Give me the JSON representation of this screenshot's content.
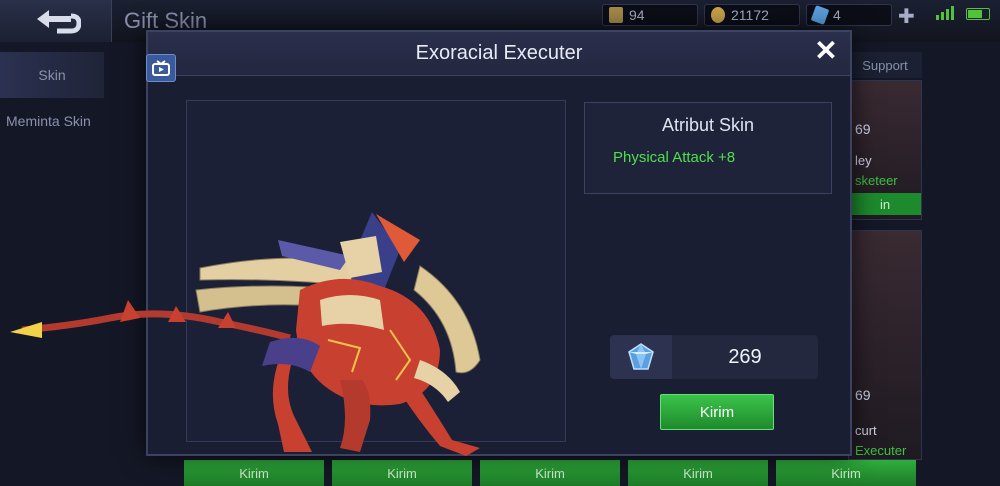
{
  "header": {
    "title": "Gift Skin",
    "resources": [
      {
        "name": "ticket",
        "value": "94",
        "color": "#a68a4a"
      },
      {
        "name": "battle-points",
        "value": "21172",
        "color": "#c9a24a"
      },
      {
        "name": "diamonds",
        "value": "4",
        "color": "#5aa0e0"
      }
    ]
  },
  "sidebar": {
    "items": [
      {
        "label": "Skin",
        "active": true
      },
      {
        "label": "Meminta Skin",
        "active": false
      }
    ]
  },
  "background": {
    "support_tab": "Support",
    "cards": [
      {
        "value": "69",
        "name": "ley",
        "role": "sketeer",
        "action": "in"
      },
      {
        "value": "69",
        "name": "curt",
        "role": "Executer",
        "action": ""
      }
    ],
    "bottom_buttons": [
      "Kirim",
      "Kirim",
      "Kirim",
      "Kirim",
      "Kirim"
    ]
  },
  "modal": {
    "title": "Exoracial Executer",
    "attributes": {
      "title": "Atribut Skin",
      "stat": "Physical Attack +8"
    },
    "price": "269",
    "send_label": "Kirim"
  },
  "colors": {
    "accent_green": "#2fae3c",
    "stat_green": "#4ee04b",
    "diamond_blue": "#5aa0e0"
  }
}
